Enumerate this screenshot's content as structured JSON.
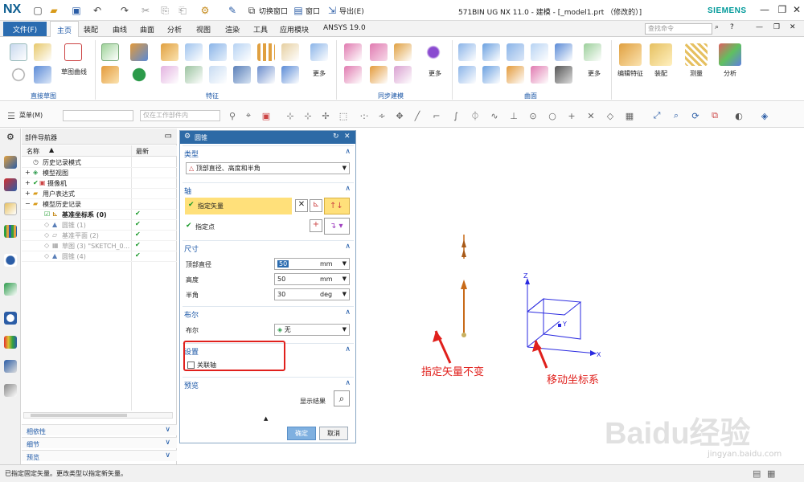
{
  "app": {
    "logo": "NX",
    "title": "571BIN UG NX 11.0 - 建模 - [_model1.prt  （修改的）]",
    "brand": "SIEMENS",
    "quick_access": {
      "switch_window": "切换窗口",
      "window": "窗口",
      "export": "导出(E)"
    }
  },
  "menu": {
    "file": "文件(F)",
    "tabs": [
      "主页",
      "装配",
      "曲线",
      "曲面",
      "分析",
      "视图",
      "渲染",
      "工具",
      "应用模块",
      "ANSYS 19.0"
    ],
    "active_tab": "主页",
    "command_search_placeholder": "查找命令"
  },
  "ribbon": {
    "groups": [
      "直接草图",
      "特征",
      "同步建模",
      "曲面"
    ],
    "labels": {
      "sketch_curve": "草图曲线",
      "more_1": "更多",
      "more_2": "更多",
      "more_3": "更多",
      "edit_feature": "编辑特征",
      "assembly": "装配",
      "measure": "测量",
      "analysis": "分析"
    }
  },
  "toolbar": {
    "menu_label": "菜单(M)",
    "filter_placeholder": "",
    "scope_placeholder": "仅在工作部件内"
  },
  "navigator": {
    "title": "部件导航器",
    "col_name": "名称",
    "col_latest": "最新",
    "items": [
      {
        "label": "历史记录模式",
        "check": ""
      },
      {
        "label": "模型视图",
        "check": ""
      },
      {
        "label": "摄像机",
        "check": ""
      },
      {
        "label": "用户表达式",
        "check": ""
      },
      {
        "label": "模型历史记录",
        "check": ""
      },
      {
        "label": "基准坐标系 (0)",
        "check": "✔"
      },
      {
        "label": "圆锥 (1)",
        "check": "✔"
      },
      {
        "label": "基准平面 (2)",
        "check": "✔"
      },
      {
        "label": "草图 (3) \"SKETCH_0...",
        "check": "✔"
      },
      {
        "label": "圆锥 (4)",
        "check": "✔"
      }
    ],
    "accordion": [
      "相依性",
      "细节",
      "预览"
    ]
  },
  "dialog": {
    "title": "圆锥",
    "type_section": "类型",
    "type_value": "顶部直径、高度和半角",
    "axis_section": "轴",
    "specify_vector": "指定矢量",
    "specify_point": "指定点",
    "dims_section": "尺寸",
    "top_diameter_label": "顶部直径",
    "top_diameter_value": "50",
    "top_diameter_unit": "mm",
    "height_label": "高度",
    "height_value": "50",
    "height_unit": "mm",
    "half_angle_label": "半角",
    "half_angle_value": "30",
    "half_angle_unit": "deg",
    "bool_section": "布尔",
    "bool_label": "布尔",
    "bool_value": "无",
    "settings_section": "设置",
    "assoc_axis": "关联轴",
    "preview_section": "预览",
    "show_result": "显示结果",
    "ok": "确定",
    "cancel": "取消"
  },
  "viewport": {
    "axis_x": "X",
    "axis_y": "Y",
    "axis_z": "Z",
    "annotation_vector": "指定矢量不变",
    "annotation_csys": "移动坐标系"
  },
  "status": {
    "message": "已指定固定矢量。更改类型以指定新矢量。"
  },
  "watermark": {
    "brand": "Baidu经验",
    "url": "jingyan.baidu.com"
  },
  "colors": {
    "accent": "#2d6aa6",
    "annotation_red": "#e0201c",
    "highlight_yellow": "#ffe07a",
    "axis_blue": "#2a2ae0",
    "vector_orange": "#c86a18"
  }
}
